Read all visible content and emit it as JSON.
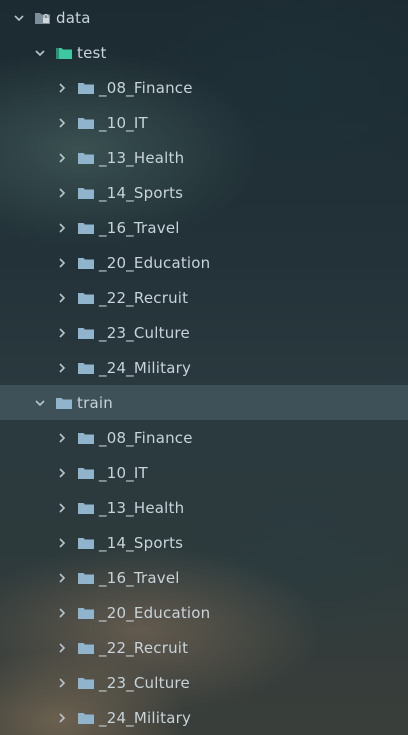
{
  "tree": {
    "root": {
      "label": "data",
      "icon": "locked-folder-icon",
      "expanded": true
    },
    "folders": [
      {
        "label": "test",
        "icon": "test-folder-icon",
        "icon_color": "#3ec7a0",
        "expanded": true,
        "selected": false,
        "children": [
          "_08_Finance",
          "_10_IT",
          "_13_Health",
          "_14_Sports",
          "_16_Travel",
          "_20_Education",
          "_22_Recruit",
          "_23_Culture",
          "_24_Military"
        ]
      },
      {
        "label": "train",
        "icon": "folder-icon",
        "icon_color": "#8fb4cc",
        "expanded": true,
        "selected": true,
        "children": [
          "_08_Finance",
          "_10_IT",
          "_13_Health",
          "_14_Sports",
          "_16_Travel",
          "_20_Education",
          "_22_Recruit",
          "_23_Culture",
          "_24_Military"
        ]
      }
    ],
    "colors": {
      "text": "#c8d3da",
      "folder": "#8fb4cc",
      "test_folder": "#3ec7a0",
      "selection": "#465a62",
      "chevron": "#b8c4cc"
    }
  }
}
